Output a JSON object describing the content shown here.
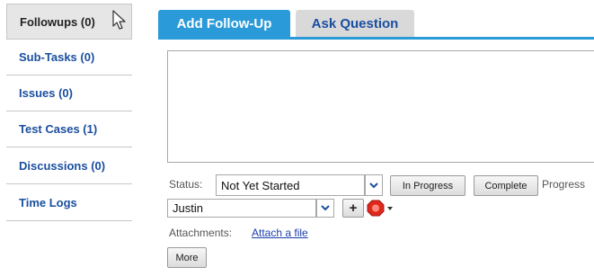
{
  "sidebar": {
    "items": [
      {
        "label": "Followups (0)",
        "active": true
      },
      {
        "label": "Sub-Tasks (0)"
      },
      {
        "label": "Issues (0)"
      },
      {
        "label": "Test Cases (1)"
      },
      {
        "label": "Discussions (0)"
      },
      {
        "label": "Time Logs"
      }
    ]
  },
  "tabs": [
    {
      "label": "Add Follow-Up",
      "active": true
    },
    {
      "label": "Ask Question"
    }
  ],
  "form": {
    "status_label": "Status:",
    "status_value": "Not Yet Started",
    "in_progress_label": "In Progress",
    "complete_label": "Complete",
    "progress_label": "Progress",
    "user_value": "Justin",
    "add_label": "+",
    "attachments_label": "Attachments:",
    "attach_link": "Attach a file",
    "more_label": "More"
  },
  "icons": {
    "cursor": "mouse-pointer-icon",
    "chevron": "chevron-down-icon",
    "priority": "priority-stop-icon"
  },
  "colors": {
    "accent": "#2a9ad8",
    "link": "#1a4fa0",
    "priority": "#e0271c"
  }
}
